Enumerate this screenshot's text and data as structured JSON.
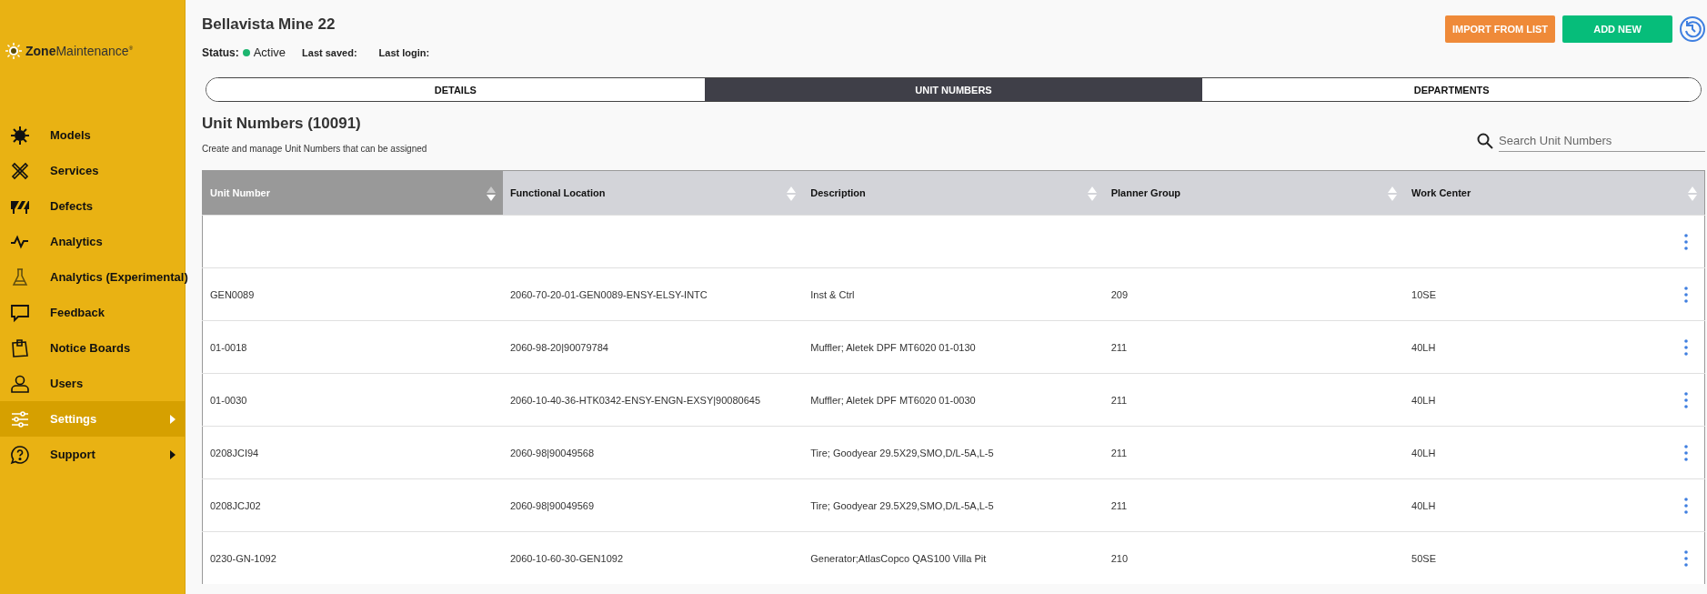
{
  "sidebar": {
    "logo": {
      "bold": "Zone",
      "light": "Maintenance",
      "mark": "®"
    },
    "items": [
      {
        "label": "Models",
        "selected": false,
        "has_submenu": false
      },
      {
        "label": "Services",
        "selected": false,
        "has_submenu": false
      },
      {
        "label": "Defects",
        "selected": false,
        "has_submenu": false
      },
      {
        "label": "Analytics",
        "selected": false,
        "has_submenu": false
      },
      {
        "label": "Analytics (Experimental)",
        "selected": false,
        "has_submenu": false
      },
      {
        "label": "Feedback",
        "selected": false,
        "has_submenu": false
      },
      {
        "label": "Notice Boards",
        "selected": false,
        "has_submenu": false
      },
      {
        "label": "Users",
        "selected": false,
        "has_submenu": false
      },
      {
        "label": "Settings",
        "selected": true,
        "has_submenu": true
      },
      {
        "label": "Support",
        "selected": false,
        "has_submenu": true
      }
    ]
  },
  "header": {
    "title": "Bellavista Mine 22",
    "status_label": "Status:",
    "status": "Active",
    "last_saved": "Last saved:",
    "last_login": "Last login:",
    "buttons": [
      {
        "label": "IMPORT FROM LIST",
        "kind": "import"
      },
      {
        "label": "ADD NEW",
        "kind": "add"
      }
    ]
  },
  "tabs": [
    {
      "label": "DETAILS",
      "selected": false
    },
    {
      "label": "UNIT NUMBERS",
      "selected": true
    },
    {
      "label": "DEPARTMENTS",
      "selected": false
    }
  ],
  "section": {
    "title": "Unit Numbers (10091)",
    "subtitle": "Create and manage Unit Numbers that can be assigned",
    "search": {
      "placeholder": "Search Unit Numbers"
    }
  },
  "table": {
    "columns": [
      {
        "label": "Unit Number",
        "sorted": true
      },
      {
        "label": "Functional Location",
        "sorted": false
      },
      {
        "label": "Description",
        "sorted": false
      },
      {
        "label": "Planner Group",
        "sorted": false
      },
      {
        "label": "Work Center",
        "sorted": false
      }
    ],
    "rows": [
      [
        "",
        "",
        "",
        "",
        ""
      ],
      [
        "GEN0089",
        "2060-70-20-01-GEN0089-ENSY-ELSY-INTC",
        "Inst & Ctrl",
        "209",
        "10SE"
      ],
      [
        "01-0018",
        "2060-98-20|90079784",
        "Muffler; Aletek DPF MT6020 01-0130",
        "211",
        "40LH"
      ],
      [
        "01-0030",
        "2060-10-40-36-HTK0342-ENSY-ENGN-EXSY|90080645",
        "Muffler; Aletek DPF MT6020 01-0030",
        "211",
        "40LH"
      ],
      [
        "0208JCI94",
        "2060-98|90049568",
        "Tire; Goodyear 29.5X29,SMO,D/L-5A,L-5",
        "211",
        "40LH"
      ],
      [
        "0208JCJ02",
        "2060-98|90049569",
        "Tire; Goodyear 29.5X29,SMO,D/L-5A,L-5",
        "211",
        "40LH"
      ],
      [
        "0230-GN-1092",
        "2060-10-60-30-GEN1092",
        "Generator;AtlasCopco QAS100 Villa Pit",
        "210",
        "50SE"
      ]
    ]
  }
}
